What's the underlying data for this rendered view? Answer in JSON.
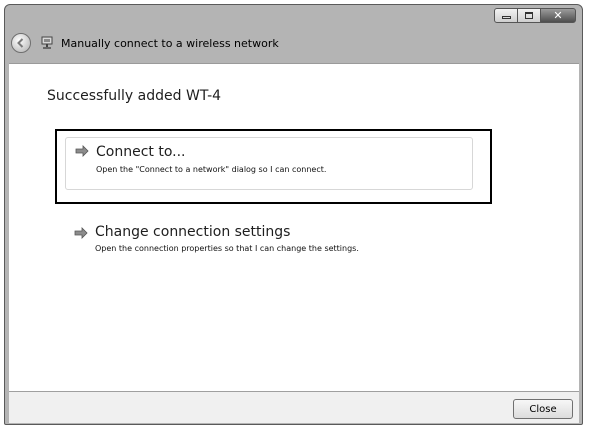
{
  "window": {
    "title": "Manually connect to a wireless network",
    "close_glyph": "✕"
  },
  "content": {
    "heading": "Successfully added WT-4",
    "options": [
      {
        "title": "Connect to...",
        "description": "Open the \"Connect to a network\" dialog so I can connect."
      },
      {
        "title": "Change connection settings",
        "description": "Open the connection properties so that I can change the settings."
      }
    ]
  },
  "footer": {
    "close_label": "Close"
  },
  "icons": {
    "back": "back-arrow-icon",
    "network": "wireless-network-icon",
    "option_arrow": "green-arrow-icon"
  }
}
